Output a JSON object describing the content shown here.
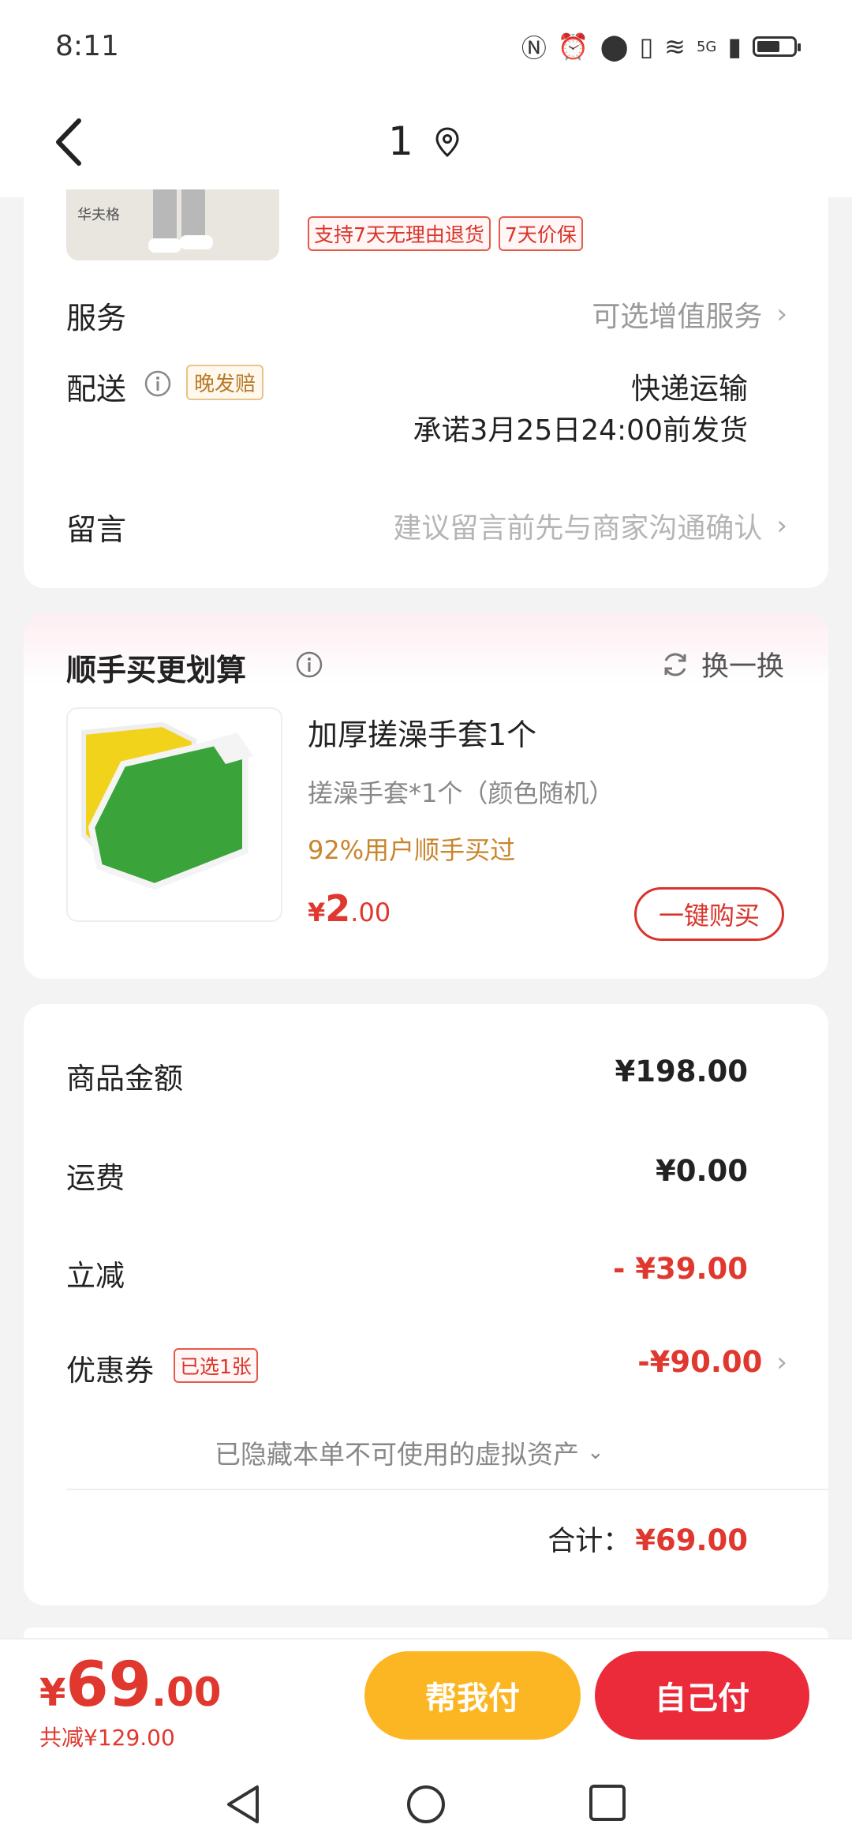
{
  "status": {
    "time": "8:11",
    "network": "5G"
  },
  "header": {
    "title": "1"
  },
  "product": {
    "image_caption": "华夫格",
    "tags": [
      "支持7天无理由退货",
      "7天价保"
    ]
  },
  "service": {
    "label": "服务",
    "value": "可选增值服务"
  },
  "delivery": {
    "label": "配送",
    "badge": "晚发赔",
    "method": "快递运输",
    "promise": "承诺3月25日24:00前发货"
  },
  "message": {
    "label": "留言",
    "placeholder": "建议留言前先与商家沟通确认"
  },
  "upsell": {
    "title": "顺手买更划算",
    "refresh_label": "换一换",
    "item": {
      "name": "加厚搓澡手套1个",
      "spec": "搓澡手套*1个（颜色随机）",
      "social_proof": "92%用户顺手买过",
      "price_symbol": "¥",
      "price_int": "2",
      "price_dec": ".00",
      "buy_label": "一键购买"
    }
  },
  "summary": {
    "goods_label": "商品金额",
    "goods_value": "¥198.00",
    "shipping_label": "运费",
    "shipping_value": "¥0.00",
    "discount_label": "立减",
    "discount_value": "- ¥39.00",
    "coupon_label": "优惠券",
    "coupon_badge": "已选1张",
    "coupon_value": "-¥90.00",
    "hidden_assets": "已隐藏本单不可使用的虚拟资产",
    "total_label": "合计：",
    "total_value": "¥69.00"
  },
  "bottom": {
    "price_symbol": "¥",
    "price_int": "69",
    "price_dec": ".00",
    "saved": "共减¥129.00",
    "help_pay": "帮我付",
    "self_pay": "自己付"
  },
  "colors": {
    "accent_red": "#e0372e",
    "help_yellow": "#fdb623",
    "pay_red": "#ec2b3a"
  }
}
